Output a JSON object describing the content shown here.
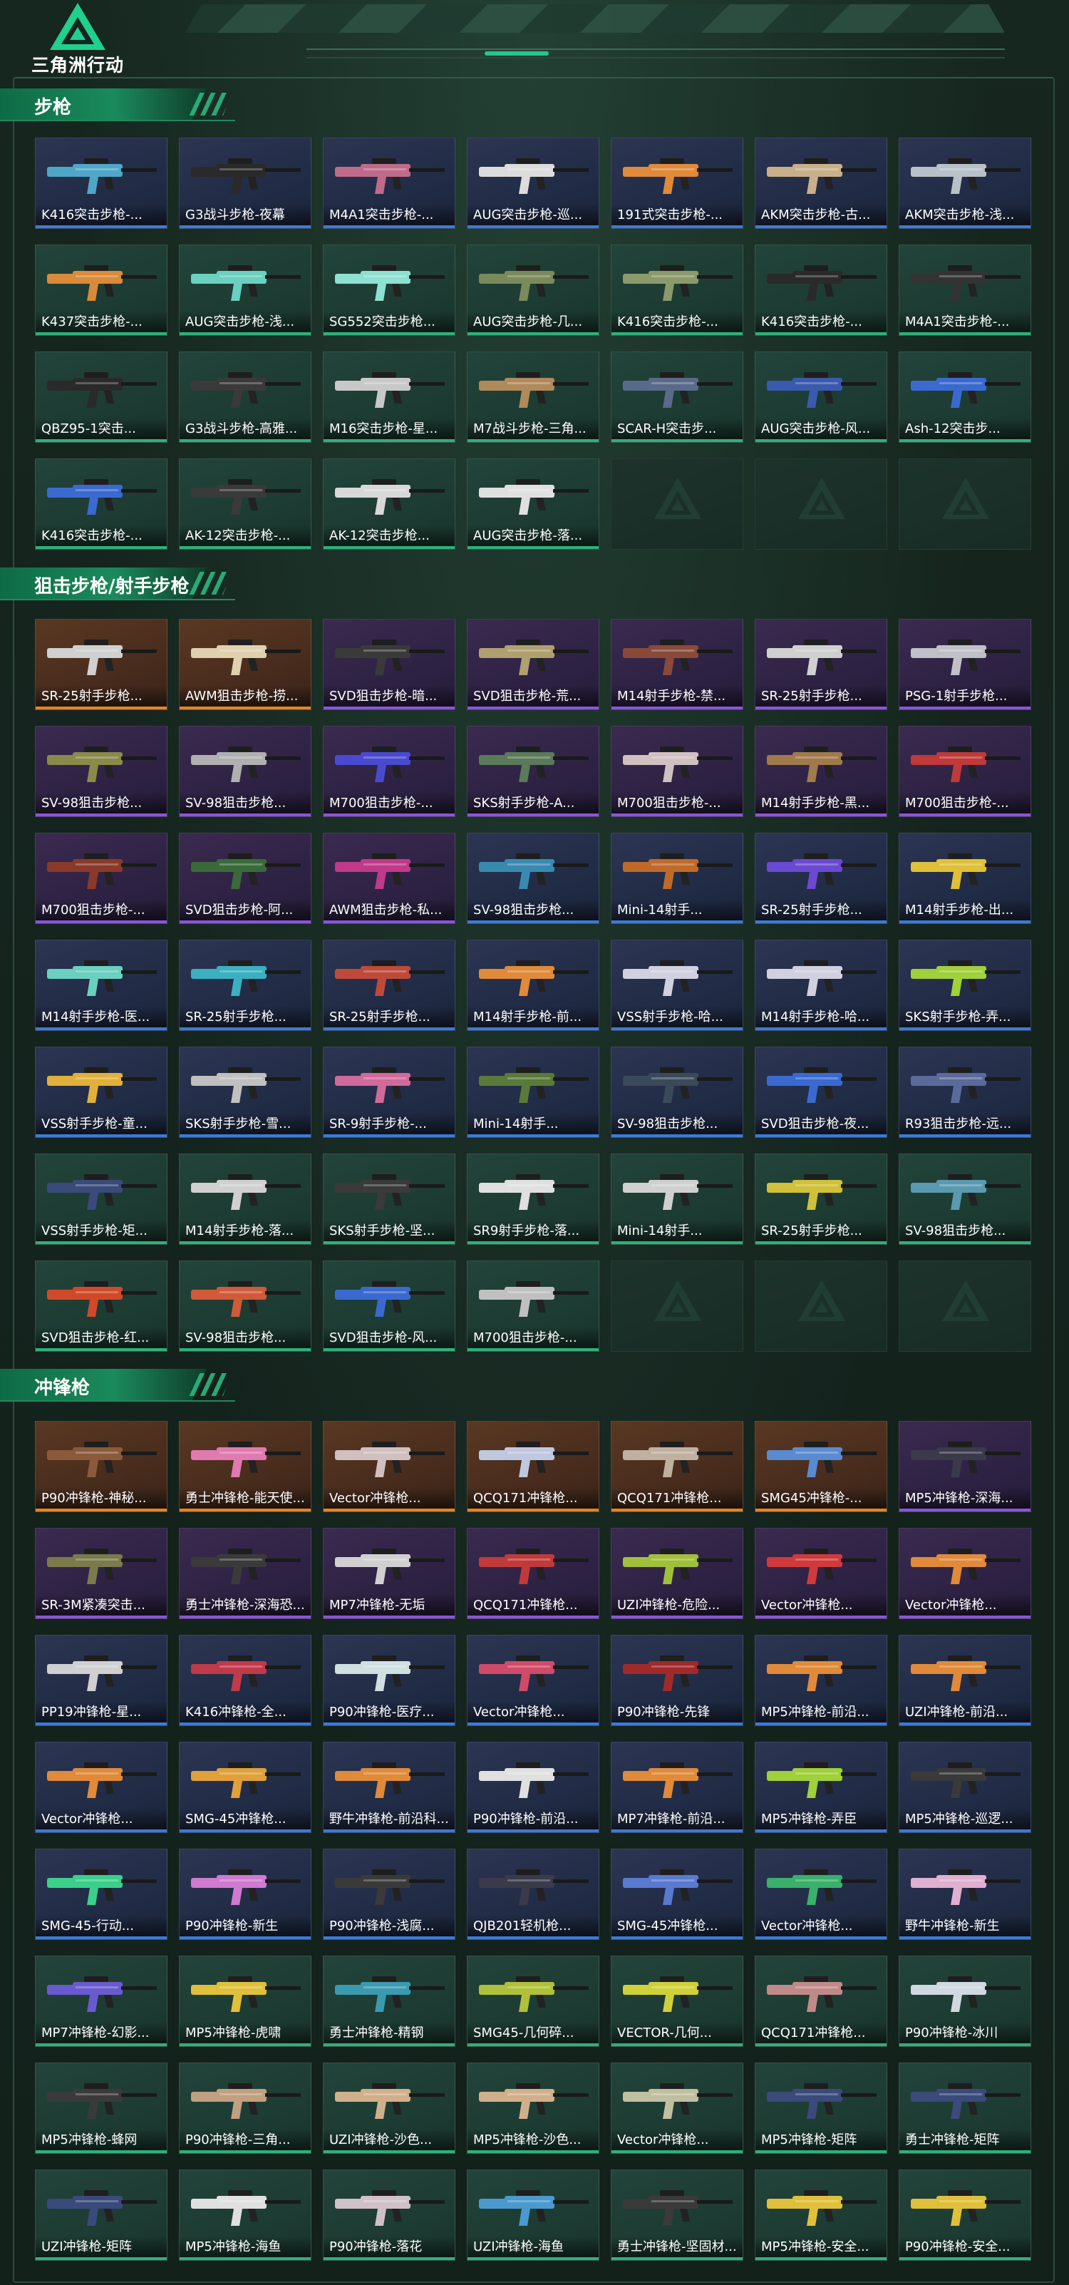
{
  "app": {
    "logo_text": "三角洲行动"
  },
  "colors": {
    "accent": "#1a8a5c",
    "blue": "#3c7bd6",
    "purple": "#8b55d9",
    "orange": "#e0852c",
    "green": "#2fb07a"
  },
  "sections": [
    {
      "title": "步枪",
      "items": [
        {
          "name": "K416突击步枪-...",
          "rarity": "blue",
          "color": "#4fa6c9"
        },
        {
          "name": "G3战斗步枪-夜幕",
          "rarity": "blue",
          "color": "#2a2a2a"
        },
        {
          "name": "M4A1突击步枪-...",
          "rarity": "blue",
          "color": "#c06a8a"
        },
        {
          "name": "AUG突击步枪-巡...",
          "rarity": "blue",
          "color": "#dcdcdc"
        },
        {
          "name": "191式突击步枪-...",
          "rarity": "blue",
          "color": "#e08a3a"
        },
        {
          "name": "AKM突击步枪-古...",
          "rarity": "blue",
          "color": "#c9b08a"
        },
        {
          "name": "AKM突击步枪-浅...",
          "rarity": "blue",
          "color": "#b8c0c8"
        },
        {
          "name": "K437突击步枪-...",
          "rarity": "green",
          "color": "#d98a3a"
        },
        {
          "name": "AUG突击步枪-浅...",
          "rarity": "green",
          "color": "#6ad0c0"
        },
        {
          "name": "SG552突击步枪...",
          "rarity": "green",
          "color": "#8ee0d0"
        },
        {
          "name": "AUG突击步枪-几...",
          "rarity": "green",
          "color": "#7a8a5a"
        },
        {
          "name": "K416突击步枪-...",
          "rarity": "green",
          "color": "#8a9a6a"
        },
        {
          "name": "K416突击步枪-...",
          "rarity": "green",
          "color": "#2a2a2a"
        },
        {
          "name": "M4A1突击步枪-...",
          "rarity": "green",
          "color": "#333333"
        },
        {
          "name": "QBZ95-1突击...",
          "rarity": "green",
          "color": "#2a2a2a"
        },
        {
          "name": "G3战斗步枪-高雅...",
          "rarity": "green",
          "color": "#3a3a3a"
        },
        {
          "name": "M16突击步枪-星...",
          "rarity": "green",
          "color": "#c8c8c8"
        },
        {
          "name": "M7战斗步枪-三角...",
          "rarity": "green",
          "color": "#b08a5a"
        },
        {
          "name": "SCAR-H突击步...",
          "rarity": "green",
          "color": "#5a6a8a"
        },
        {
          "name": "AUG突击步枪-风...",
          "rarity": "green",
          "color": "#3a5ab0"
        },
        {
          "name": "Ash-12突击步...",
          "rarity": "green",
          "color": "#3a6ad0"
        },
        {
          "name": "K416突击步枪-...",
          "rarity": "green",
          "color": "#3a6ad0"
        },
        {
          "name": "AK-12突击步枪-...",
          "rarity": "green",
          "color": "#3a3a3a"
        },
        {
          "name": "AK-12突击步枪...",
          "rarity": "green",
          "color": "#d8d8d8"
        },
        {
          "name": "AUG突击步枪-落...",
          "rarity": "green",
          "color": "#e0e0e0"
        }
      ],
      "empty_slots": 3
    },
    {
      "title": "狙击步枪/射手步枪",
      "items": [
        {
          "name": "SR-25射手步枪...",
          "rarity": "orange",
          "color": "#d0d0d0"
        },
        {
          "name": "AWM狙击步枪-捞...",
          "rarity": "orange",
          "color": "#e0d0b0"
        },
        {
          "name": "SVD狙击步枪-暗...",
          "rarity": "purple",
          "color": "#3a3a3a"
        },
        {
          "name": "SVD狙击步枪-荒...",
          "rarity": "purple",
          "color": "#b0a070"
        },
        {
          "name": "M14射手步枪-禁...",
          "rarity": "purple",
          "color": "#8a4a3a"
        },
        {
          "name": "SR-25射手步枪...",
          "rarity": "purple",
          "color": "#d0d0d0"
        },
        {
          "name": "PSG-1射手步枪...",
          "rarity": "purple",
          "color": "#c0c0c8"
        },
        {
          "name": "SV-98狙击步枪...",
          "rarity": "purple",
          "color": "#8a8a4a"
        },
        {
          "name": "SV-98狙击步枪...",
          "rarity": "purple",
          "color": "#b0b0b0"
        },
        {
          "name": "M700狙击步枪-...",
          "rarity": "purple",
          "color": "#4a4ad0"
        },
        {
          "name": "SKS射手步枪-A...",
          "rarity": "purple",
          "color": "#5a7a5a"
        },
        {
          "name": "M700狙击步枪-...",
          "rarity": "purple",
          "color": "#d0c0c0"
        },
        {
          "name": "M14射手步枪-黑...",
          "rarity": "purple",
          "color": "#a07a4a"
        },
        {
          "name": "M700狙击步枪-...",
          "rarity": "purple",
          "color": "#c03a3a"
        },
        {
          "name": "M700狙击步枪-...",
          "rarity": "purple",
          "color": "#8a3a2a"
        },
        {
          "name": "SVD狙击步枪-阿...",
          "rarity": "purple",
          "color": "#3a6a3a"
        },
        {
          "name": "AWM狙击步枪-私...",
          "rarity": "purple",
          "color": "#c03a8a"
        },
        {
          "name": "SV-98狙击步枪...",
          "rarity": "blue",
          "color": "#3a8ab0"
        },
        {
          "name": "Mini-14射手...",
          "rarity": "blue",
          "color": "#c06a2a"
        },
        {
          "name": "SR-25射手步枪...",
          "rarity": "blue",
          "color": "#6a4ad0"
        },
        {
          "name": "M14射手步枪-出...",
          "rarity": "blue",
          "color": "#e0c03a"
        },
        {
          "name": "M14射手步枪-医...",
          "rarity": "blue",
          "color": "#6ad0c0"
        },
        {
          "name": "SR-25射手步枪...",
          "rarity": "blue",
          "color": "#3ab0c0"
        },
        {
          "name": "SR-25射手步枪...",
          "rarity": "blue",
          "color": "#c04a3a"
        },
        {
          "name": "M14射手步枪-前...",
          "rarity": "blue",
          "color": "#e08a3a"
        },
        {
          "name": "VSS射手步枪-哈...",
          "rarity": "blue",
          "color": "#d0d0e0"
        },
        {
          "name": "M14射手步枪-哈...",
          "rarity": "blue",
          "color": "#d0d0e0"
        },
        {
          "name": "SKS射手步枪-弄...",
          "rarity": "blue",
          "color": "#a0d03a"
        },
        {
          "name": "VSS射手步枪-童...",
          "rarity": "blue",
          "color": "#e0b03a"
        },
        {
          "name": "SKS射手步枪-雪...",
          "rarity": "blue",
          "color": "#c0c0c0"
        },
        {
          "name": "SR-9射手步枪-...",
          "rarity": "blue",
          "color": "#d06a9a"
        },
        {
          "name": "Mini-14射手...",
          "rarity": "blue",
          "color": "#5a7a3a"
        },
        {
          "name": "SV-98狙击步枪...",
          "rarity": "blue",
          "color": "#3a4a5a"
        },
        {
          "name": "SVD狙击步枪-夜...",
          "rarity": "blue",
          "color": "#3a6ad0"
        },
        {
          "name": "R93狙击步枪-远...",
          "rarity": "blue",
          "color": "#5a6a9a"
        },
        {
          "name": "VSS射手步枪-矩...",
          "rarity": "green",
          "color": "#3a4a7a"
        },
        {
          "name": "M14射手步枪-落...",
          "rarity": "green",
          "color": "#d0d0d0"
        },
        {
          "name": "SKS射手步枪-坚...",
          "rarity": "green",
          "color": "#3a3a3a"
        },
        {
          "name": "SR9射手步枪-落...",
          "rarity": "green",
          "color": "#e0e0e0"
        },
        {
          "name": "Mini-14射手...",
          "rarity": "green",
          "color": "#d0d0d0"
        },
        {
          "name": "SR-25射手步枪...",
          "rarity": "green",
          "color": "#d0c03a"
        },
        {
          "name": "SV-98狙击步枪...",
          "rarity": "green",
          "color": "#5a9ab0"
        },
        {
          "name": "SVD狙击步枪-红...",
          "rarity": "green",
          "color": "#d04a2a"
        },
        {
          "name": "SV-98狙击步枪...",
          "rarity": "green",
          "color": "#d05a3a"
        },
        {
          "name": "SVD狙击步枪-风...",
          "rarity": "green",
          "color": "#3a6ad0"
        },
        {
          "name": "M700狙击步枪-...",
          "rarity": "green",
          "color": "#c0c0c0"
        }
      ],
      "empty_slots": 3
    },
    {
      "title": "冲锋枪",
      "items": [
        {
          "name": "P90冲锋枪-神秘...",
          "rarity": "orange",
          "color": "#8a5a3a"
        },
        {
          "name": "勇士冲锋枪-能天使...",
          "rarity": "orange",
          "color": "#e07ab0"
        },
        {
          "name": "Vector冲锋枪...",
          "rarity": "orange",
          "color": "#d0c0c0"
        },
        {
          "name": "QCQ171冲锋枪...",
          "rarity": "orange",
          "color": "#c0c8e0"
        },
        {
          "name": "QCQ171冲锋枪...",
          "rarity": "orange",
          "color": "#c0b0a0"
        },
        {
          "name": "SMG45冲锋枪-...",
          "rarity": "orange",
          "color": "#5a8ad0"
        },
        {
          "name": "MP5冲锋枪-深海...",
          "rarity": "purple",
          "color": "#3a3a4a"
        },
        {
          "name": "SR-3M紧凑突击...",
          "rarity": "purple",
          "color": "#7a7a4a"
        },
        {
          "name": "勇士冲锋枪-深海恐...",
          "rarity": "purple",
          "color": "#3a3a3a"
        },
        {
          "name": "MP7冲锋枪-无垢",
          "rarity": "purple",
          "color": "#d0d0d0"
        },
        {
          "name": "QCQ171冲锋枪...",
          "rarity": "purple",
          "color": "#c03a3a"
        },
        {
          "name": "UZI冲锋枪-危险...",
          "rarity": "purple",
          "color": "#a0c03a"
        },
        {
          "name": "Vector冲锋枪...",
          "rarity": "purple",
          "color": "#d03a3a"
        },
        {
          "name": "Vector冲锋枪...",
          "rarity": "purple",
          "color": "#e08a3a"
        },
        {
          "name": "PP19冲锋枪-星...",
          "rarity": "blue",
          "color": "#d0d0d0"
        },
        {
          "name": "K416冲锋枪-全...",
          "rarity": "blue",
          "color": "#c03a4a"
        },
        {
          "name": "P90冲锋枪-医疗...",
          "rarity": "blue",
          "color": "#d0e0e0"
        },
        {
          "name": "Vector冲锋枪...",
          "rarity": "blue",
          "color": "#d04a6a"
        },
        {
          "name": "P90冲锋枪-先锋",
          "rarity": "blue",
          "color": "#a02a2a"
        },
        {
          "name": "MP5冲锋枪-前沿...",
          "rarity": "blue",
          "color": "#e08a3a"
        },
        {
          "name": "UZI冲锋枪-前沿...",
          "rarity": "blue",
          "color": "#e08a3a"
        },
        {
          "name": "Vector冲锋枪...",
          "rarity": "blue",
          "color": "#e08a3a"
        },
        {
          "name": "SMG-45冲锋枪...",
          "rarity": "blue",
          "color": "#e0a03a"
        },
        {
          "name": "野牛冲锋枪-前沿科...",
          "rarity": "blue",
          "color": "#e08a3a"
        },
        {
          "name": "P90冲锋枪-前沿...",
          "rarity": "blue",
          "color": "#e0e0e0"
        },
        {
          "name": "MP7冲锋枪-前沿...",
          "rarity": "blue",
          "color": "#e08a3a"
        },
        {
          "name": "MP5冲锋枪-弄臣",
          "rarity": "blue",
          "color": "#a0d03a"
        },
        {
          "name": "MP5冲锋枪-巡逻...",
          "rarity": "blue",
          "color": "#3a3a3a"
        },
        {
          "name": "SMG-45-行动...",
          "rarity": "blue",
          "color": "#3ad08a"
        },
        {
          "name": "P90冲锋枪-新生",
          "rarity": "blue",
          "color": "#d07ad0"
        },
        {
          "name": "P90冲锋枪-浅腐...",
          "rarity": "blue",
          "color": "#3a3a3a"
        },
        {
          "name": "QJB201轻机枪...",
          "rarity": "blue",
          "color": "#3a3a4a"
        },
        {
          "name": "SMG-45冲锋枪...",
          "rarity": "blue",
          "color": "#5a7ad0"
        },
        {
          "name": "Vector冲锋枪...",
          "rarity": "blue",
          "color": "#3ab06a"
        },
        {
          "name": "野牛冲锋枪-新生",
          "rarity": "blue",
          "color": "#e0b0d0"
        },
        {
          "name": "MP7冲锋枪-幻影...",
          "rarity": "green",
          "color": "#6a5ad0"
        },
        {
          "name": "MP5冲锋枪-虎啸",
          "rarity": "green",
          "color": "#e0c03a"
        },
        {
          "name": "勇士冲锋枪-精钢",
          "rarity": "green",
          "color": "#3a9ab0"
        },
        {
          "name": "SMG45-几何碎...",
          "rarity": "green",
          "color": "#b0c03a"
        },
        {
          "name": "VECTOR-几何...",
          "rarity": "green",
          "color": "#d0d03a"
        },
        {
          "name": "QCQ171冲锋枪...",
          "rarity": "green",
          "color": "#c08a8a"
        },
        {
          "name": "P90冲锋枪-冰川",
          "rarity": "green",
          "color": "#d0d8e0"
        },
        {
          "name": "MP5冲锋枪-蜂网",
          "rarity": "green",
          "color": "#3a3a3a"
        },
        {
          "name": "P90冲锋枪-三角...",
          "rarity": "green",
          "color": "#c0a080"
        },
        {
          "name": "UZI冲锋枪-沙色...",
          "rarity": "green",
          "color": "#d0b08a"
        },
        {
          "name": "MP5冲锋枪-沙色...",
          "rarity": "green",
          "color": "#d0b08a"
        },
        {
          "name": "Vector冲锋枪...",
          "rarity": "green",
          "color": "#c0c0a0"
        },
        {
          "name": "MP5冲锋枪-矩阵",
          "rarity": "green",
          "color": "#3a4a7a"
        },
        {
          "name": "勇士冲锋枪-矩阵",
          "rarity": "green",
          "color": "#3a4a7a"
        },
        {
          "name": "UZI冲锋枪-矩阵",
          "rarity": "green",
          "color": "#3a4a7a"
        },
        {
          "name": "MP5冲锋枪-海鱼",
          "rarity": "green",
          "color": "#e0e0e0"
        },
        {
          "name": "P90冲锋枪-落花",
          "rarity": "green",
          "color": "#d0c0c8"
        },
        {
          "name": "UZI冲锋枪-海鱼",
          "rarity": "green",
          "color": "#4a9ad0"
        },
        {
          "name": "勇士冲锋枪-坚固材...",
          "rarity": "green",
          "color": "#3a3a3a"
        },
        {
          "name": "MP5冲锋枪-安全...",
          "rarity": "green",
          "color": "#e0c03a"
        },
        {
          "name": "P90冲锋枪-安全...",
          "rarity": "green",
          "color": "#e0c03a"
        }
      ],
      "empty_slots": 0
    }
  ]
}
